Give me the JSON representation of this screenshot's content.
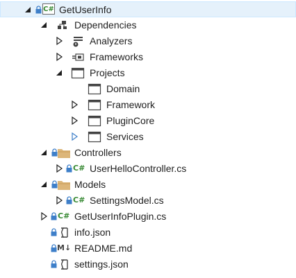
{
  "tree": {
    "project": {
      "label": "GetUserInfo",
      "badge": "C#"
    },
    "dependencies": {
      "label": "Dependencies",
      "analyzers": "Analyzers",
      "frameworks": "Frameworks",
      "projects": {
        "label": "Projects",
        "items": [
          "Domain",
          "Framework",
          "PluginCore",
          "Services"
        ]
      }
    },
    "controllers": {
      "label": "Controllers",
      "files": [
        {
          "label": "UserHelloController.cs",
          "badge": "C#"
        }
      ]
    },
    "models": {
      "label": "Models",
      "files": [
        {
          "label": "SettingsModel.cs",
          "badge": "C#"
        }
      ]
    },
    "root_files": [
      {
        "label": "GetUserInfoPlugin.cs",
        "badge": "C#"
      },
      {
        "label": "info.json"
      },
      {
        "label": "README.md",
        "badge": "M↓"
      },
      {
        "label": "settings.json"
      }
    ]
  },
  "colors": {
    "selection_bg": "#e5f1fb",
    "csharp_green": "#388a34",
    "folder_tan": "#dcb67a",
    "lock_blue": "#3e7fc9",
    "arrow_blue": "#3e7fc9"
  }
}
